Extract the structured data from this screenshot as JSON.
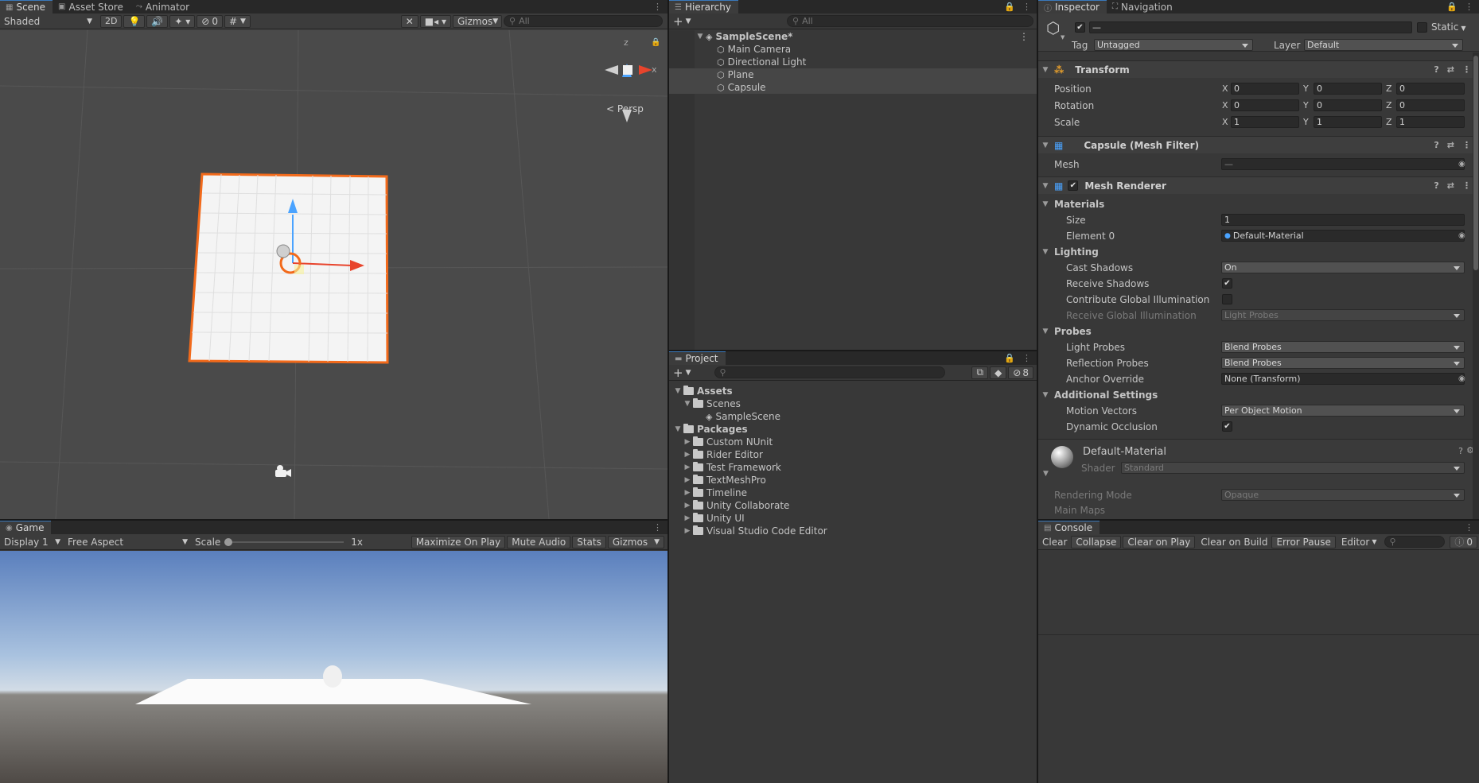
{
  "scene": {
    "tabs": [
      "Scene",
      "Asset Store",
      "Animator"
    ],
    "toolbar": {
      "shading": "Shaded",
      "mode2d": "2D",
      "hidden_count": "0",
      "gizmos": "Gizmos",
      "search_placeholder": "All"
    },
    "gizmo": {
      "axis_z": "z",
      "axis_x": "x",
      "projection": "Persp"
    }
  },
  "game": {
    "tab": "Game",
    "toolbar": {
      "display": "Display 1",
      "aspect": "Free Aspect",
      "scale_label": "Scale",
      "scale_value": "1x",
      "maximize": "Maximize On Play",
      "mute": "Mute Audio",
      "stats": "Stats",
      "gizmos": "Gizmos"
    }
  },
  "hierarchy": {
    "tab": "Hierarchy",
    "search_placeholder": "All",
    "scene_name": "SampleScene*",
    "objects": [
      "Main Camera",
      "Directional Light",
      "Plane",
      "Capsule"
    ]
  },
  "project": {
    "tab": "Project",
    "hidden_count": "8",
    "assets_label": "Assets",
    "scenes_label": "Scenes",
    "scene_file": "SampleScene",
    "packages_label": "Packages",
    "packages": [
      "Custom NUnit",
      "Rider Editor",
      "Test Framework",
      "TextMeshPro",
      "Timeline",
      "Unity Collaborate",
      "Unity UI",
      "Visual Studio Code Editor"
    ]
  },
  "inspector": {
    "tabs": [
      "Inspector",
      "Navigation"
    ],
    "object_name": "—",
    "static_label": "Static",
    "tag_label": "Tag",
    "tag_value": "Untagged",
    "layer_label": "Layer",
    "layer_value": "Default",
    "transform": {
      "title": "Transform",
      "rows": [
        {
          "label": "Position",
          "x": "0",
          "y": "0",
          "z": "0"
        },
        {
          "label": "Rotation",
          "x": "0",
          "y": "0",
          "z": "0"
        },
        {
          "label": "Scale",
          "x": "1",
          "y": "1",
          "z": "1"
        }
      ],
      "x_label": "X",
      "y_label": "Y",
      "z_label": "Z"
    },
    "mesh_filter": {
      "title": "Capsule (Mesh Filter)",
      "mesh_label": "Mesh",
      "mesh_value": "—"
    },
    "mesh_renderer": {
      "title": "Mesh Renderer",
      "materials_label": "Materials",
      "size_label": "Size",
      "size_value": "1",
      "element0_label": "Element 0",
      "element0_value": "Default-Material",
      "lighting_label": "Lighting",
      "cast_shadows_label": "Cast Shadows",
      "cast_shadows_value": "On",
      "receive_shadows_label": "Receive Shadows",
      "contribute_gi_label": "Contribute Global Illumination",
      "receive_gi_label": "Receive Global Illumination",
      "receive_gi_value": "Light Probes",
      "probes_label": "Probes",
      "light_probes_label": "Light Probes",
      "light_probes_value": "Blend Probes",
      "reflection_probes_label": "Reflection Probes",
      "reflection_probes_value": "Blend Probes",
      "anchor_label": "Anchor Override",
      "anchor_value": "None (Transform)",
      "additional_label": "Additional Settings",
      "motion_vectors_label": "Motion Vectors",
      "motion_vectors_value": "Per Object Motion",
      "dynamic_occlusion_label": "Dynamic Occlusion"
    },
    "material": {
      "name": "Default-Material",
      "shader_label": "Shader",
      "shader_value": "Standard",
      "rendering_mode_label": "Rendering Mode",
      "rendering_mode_value": "Opaque",
      "main_maps_label": "Main Maps"
    }
  },
  "console": {
    "tab": "Console",
    "buttons": [
      "Clear",
      "Collapse",
      "Clear on Play",
      "Clear on Build",
      "Error Pause",
      "Editor"
    ],
    "error_count": "0"
  },
  "colors": {
    "selection_orange": "#f26a1b",
    "axis_x": "#e8442c",
    "axis_y": "#4aa3ff",
    "accent_tab": "#3a79bb"
  }
}
